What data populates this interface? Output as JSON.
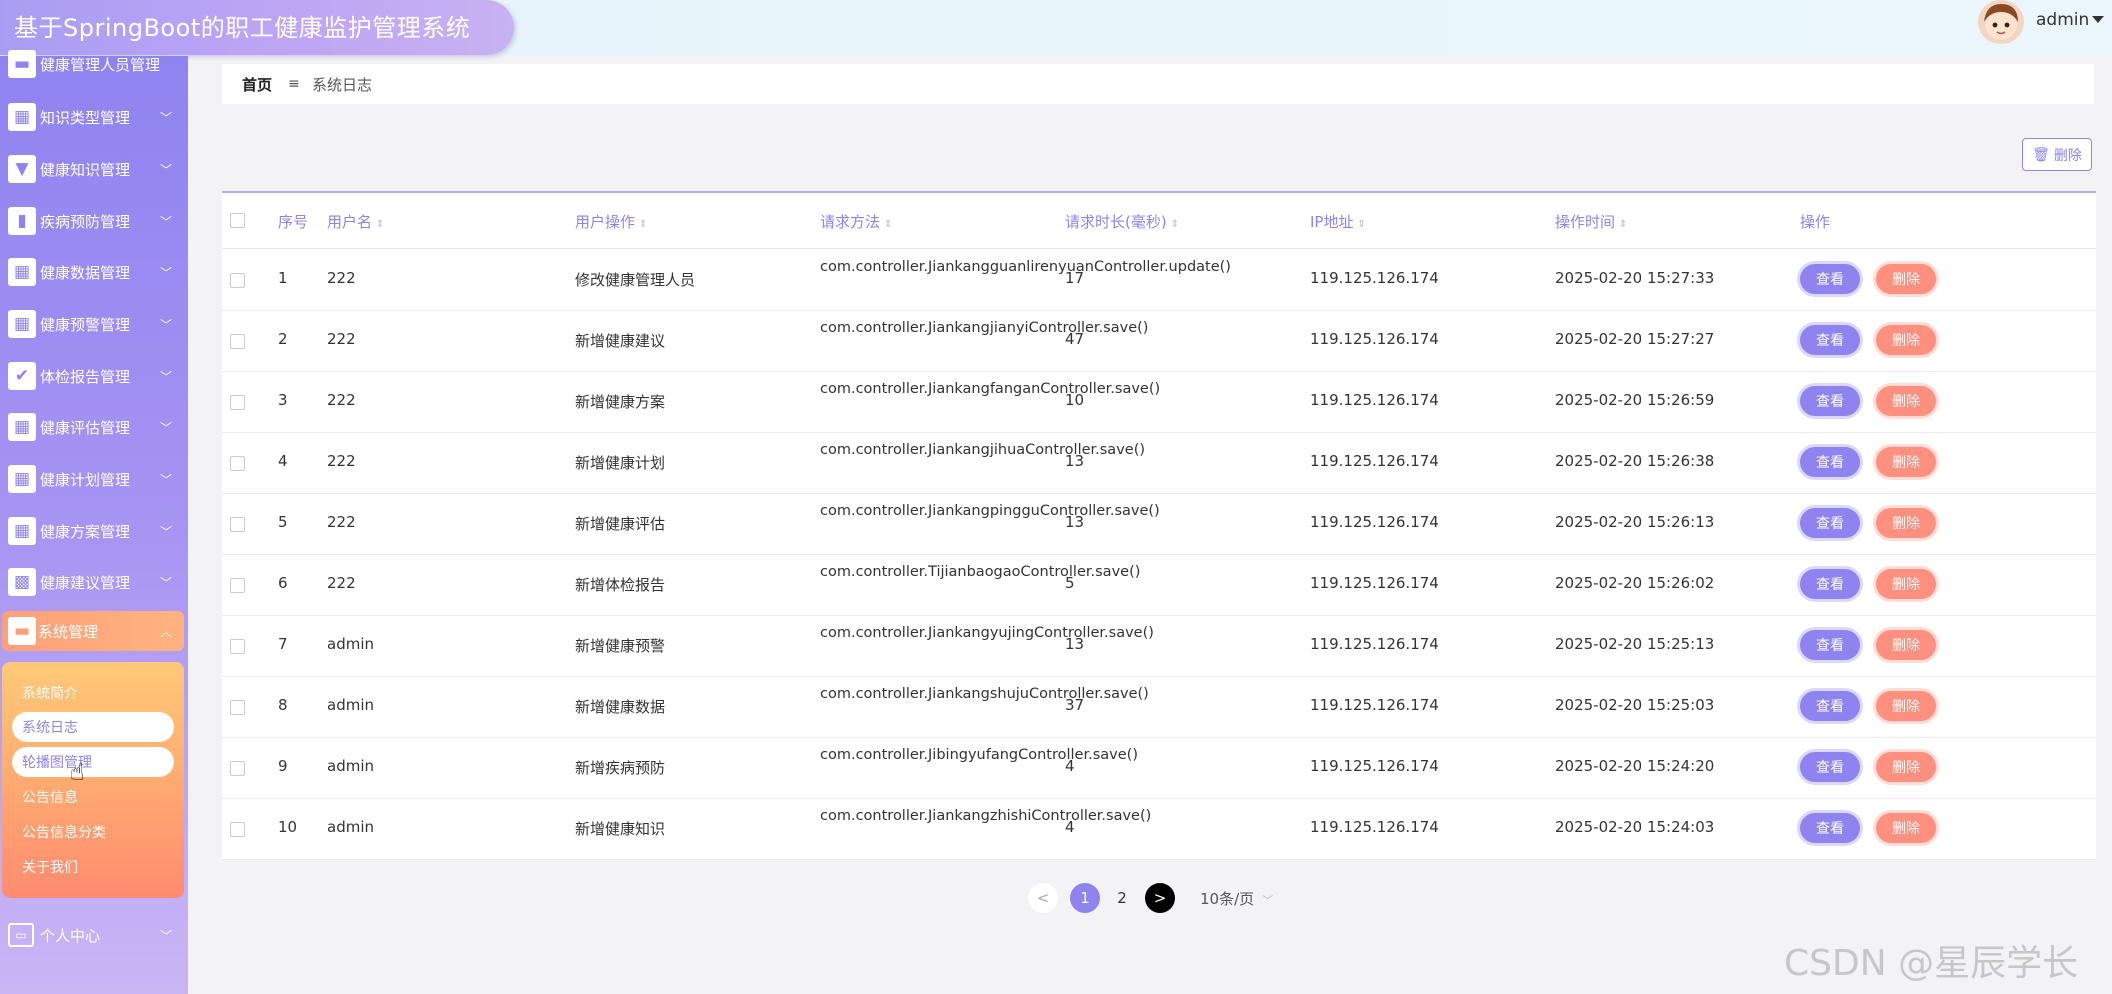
{
  "header": {
    "title": "基于SpringBoot的职工健康监护管理系统",
    "user": "admin"
  },
  "sidebar": {
    "items": [
      {
        "label": "健康管理人员管理",
        "icon": "person-icon"
      },
      {
        "label": "知识类型管理",
        "icon": "grid-icon"
      },
      {
        "label": "健康知识管理",
        "icon": "stamp-icon"
      },
      {
        "label": "疾病预防管理",
        "icon": "bar-chart-icon"
      },
      {
        "label": "健康数据管理",
        "icon": "grid-icon"
      },
      {
        "label": "健康预警管理",
        "icon": "grid-icon"
      },
      {
        "label": "体检报告管理",
        "icon": "clipboard-icon"
      },
      {
        "label": "健康评估管理",
        "icon": "grid-icon"
      },
      {
        "label": "健康计划管理",
        "icon": "grid-icon"
      },
      {
        "label": "健康方案管理",
        "icon": "grid-icon"
      },
      {
        "label": "健康建议管理",
        "icon": "apps-icon"
      },
      {
        "label": "系统管理",
        "icon": "monitor-icon"
      },
      {
        "label": "个人中心",
        "icon": "card-icon"
      }
    ],
    "submenu": [
      "系统简介",
      "系统日志",
      "轮播图管理",
      "公告信息",
      "公告信息分类",
      "关于我们"
    ]
  },
  "breadcrumb": {
    "home": "首页",
    "sep": "≡",
    "current": "系统日志"
  },
  "toolbar": {
    "delete_label": "删除"
  },
  "table": {
    "headers": [
      "序号",
      "用户名",
      "用户操作",
      "请求方法",
      "请求时长(毫秒)",
      "IP地址",
      "操作时间",
      "操作"
    ],
    "rows": [
      {
        "no": "1",
        "user": "222",
        "op": "修改健康管理人员",
        "method": "com.controller.JiankangguanlirenyuanController.update()",
        "dur": "17",
        "ip": "119.125.126.174",
        "time": "2025-02-20 15:27:33"
      },
      {
        "no": "2",
        "user": "222",
        "op": "新增健康建议",
        "method": "com.controller.JiankangjianyiController.save()",
        "dur": "47",
        "ip": "119.125.126.174",
        "time": "2025-02-20 15:27:27"
      },
      {
        "no": "3",
        "user": "222",
        "op": "新增健康方案",
        "method": "com.controller.JiankangfanganController.save()",
        "dur": "10",
        "ip": "119.125.126.174",
        "time": "2025-02-20 15:26:59"
      },
      {
        "no": "4",
        "user": "222",
        "op": "新增健康计划",
        "method": "com.controller.JiankangjihuaController.save()",
        "dur": "13",
        "ip": "119.125.126.174",
        "time": "2025-02-20 15:26:38"
      },
      {
        "no": "5",
        "user": "222",
        "op": "新增健康评估",
        "method": "com.controller.JiankangpingguController.save()",
        "dur": "13",
        "ip": "119.125.126.174",
        "time": "2025-02-20 15:26:13"
      },
      {
        "no": "6",
        "user": "222",
        "op": "新增体检报告",
        "method": "com.controller.TijianbaogaoController.save()",
        "dur": "5",
        "ip": "119.125.126.174",
        "time": "2025-02-20 15:26:02"
      },
      {
        "no": "7",
        "user": "admin",
        "op": "新增健康预警",
        "method": "com.controller.JiankangyujingController.save()",
        "dur": "13",
        "ip": "119.125.126.174",
        "time": "2025-02-20 15:25:13"
      },
      {
        "no": "8",
        "user": "admin",
        "op": "新增健康数据",
        "method": "com.controller.JiankangshujuController.save()",
        "dur": "37",
        "ip": "119.125.126.174",
        "time": "2025-02-20 15:25:03"
      },
      {
        "no": "9",
        "user": "admin",
        "op": "新增疾病预防",
        "method": "com.controller.JibingyufangController.save()",
        "dur": "4",
        "ip": "119.125.126.174",
        "time": "2025-02-20 15:24:20"
      },
      {
        "no": "10",
        "user": "admin",
        "op": "新增健康知识",
        "method": "com.controller.JiankangzhishiController.save()",
        "dur": "4",
        "ip": "119.125.126.174",
        "time": "2025-02-20 15:24:03"
      }
    ],
    "view_label": "查看",
    "delete_label": "删除"
  },
  "pagination": {
    "prev": "<",
    "pages": [
      "1",
      "2"
    ],
    "current": "1",
    "next": ">",
    "size": "10条/页"
  },
  "watermark": "CSDN @星辰学长",
  "colors": {
    "accent": "#8f83f0",
    "danger": "#ff8f7e",
    "sidebar": "#a794f3"
  }
}
